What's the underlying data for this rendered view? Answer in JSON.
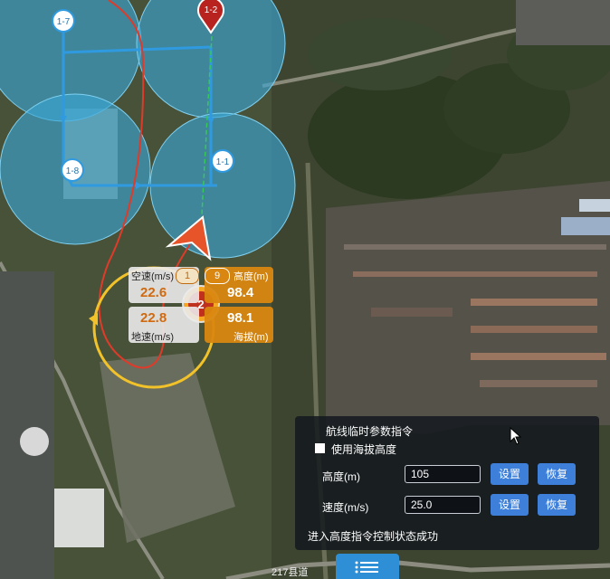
{
  "waypoints": [
    {
      "label": "1-7"
    },
    {
      "label": "1-2"
    },
    {
      "label": "1-8"
    },
    {
      "label": "1-1"
    }
  ],
  "hud": {
    "airspeed_label": "空速(m/s)",
    "airspeed_value": "22.6",
    "groundspeed_value": "22.8",
    "groundspeed_label": "地速(m/s)",
    "height_label": "高度(m)",
    "height_value": "98.4",
    "altitude_value": "98.1",
    "altitude_label": "海拔(m)",
    "badge_left": "1",
    "badge_right": "9",
    "center_number": "2"
  },
  "panel": {
    "title": "航线临时参数指令",
    "use_altitude_label": "使用海拔高度",
    "use_altitude_checked": false,
    "height_label": "高度(m)",
    "height_value": "105",
    "speed_label": "速度(m/s)",
    "speed_value": "25.0",
    "set_label": "设置",
    "restore_label": "恢复",
    "status": "进入高度指令控制状态成功"
  },
  "map_labels": {
    "road": "217县道"
  },
  "colors": {
    "zone": "#3aa6d6",
    "route": "#2f9ae0",
    "track": "#e03a2a",
    "hud_orange": "#d98710",
    "button": "#3d7fd9"
  }
}
